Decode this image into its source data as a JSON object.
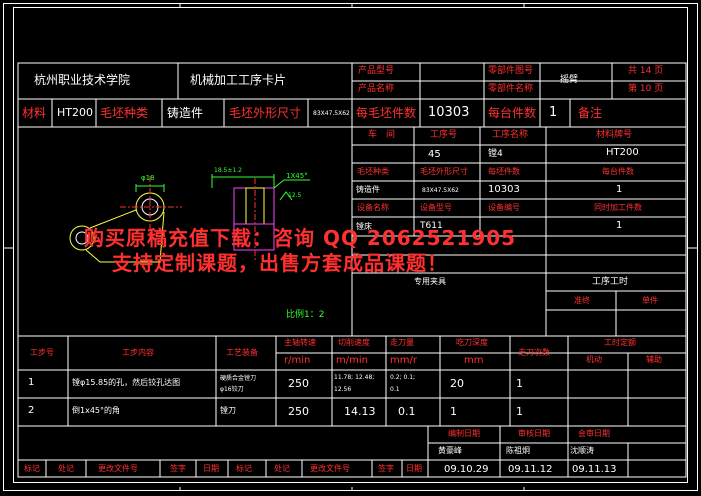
{
  "header": {
    "school": "杭州职业技术学院",
    "card_title": "机械加工工序卡片",
    "product_model_label": "产品型号",
    "product_name_label": "产品名称",
    "part_drawing_no_label": "零部件图号",
    "part_name_label": "零部件名称",
    "part_name_value": "摇臂",
    "total_pages": "共 14 页",
    "page_no": "第 10 页",
    "material_label": "材料",
    "material_value": "HT200",
    "blank_type_label": "毛坯种类",
    "blank_type_value": "铸造件",
    "blank_size_label": "毛坯外形尺寸",
    "blank_size_value": "83X47.5X62",
    "blanks_count_label": "每毛坯件数",
    "blanks_count_value": "10303",
    "per_unit_label": "每台件数",
    "per_unit_value": "1",
    "remark_label": "备注"
  },
  "info": {
    "workshop_label": "车　间",
    "process_no_label": "工序号",
    "process_name_label": "工序名称",
    "material_no_label": "材料牌号",
    "process_no_value": "45",
    "process_name_value": "镗4",
    "material_no_value": "HT200",
    "blank_type_label": "毛坯种类",
    "blank_size_label": "毛坯外形尺寸",
    "blank_count_label": "每坯件数",
    "per_unit_label": "每台件数",
    "blank_type_value": "铸造件",
    "blank_size_value": "83X47.5X62",
    "blank_count_value": "10303",
    "per_unit_value": "1",
    "equip_name_label": "设备名称",
    "equip_model_label": "设备型号",
    "equip_no_label": "设备编号",
    "simul_parts_label": "同时加工件数",
    "equip_name_value": "镗床",
    "equip_model_value": "T611",
    "simul_parts_value": "1",
    "fixture_value": "专用夹具",
    "work_hours_label": "工序工时",
    "prep_label": "准终",
    "unit_label": "单件"
  },
  "drawing": {
    "dim_diameter": "φ18",
    "dim_length": "18.5±1.2",
    "dim_chamfer": "1X45°",
    "dim_roughness": "12.5",
    "scale": "比例1：2"
  },
  "watermark": {
    "line1": "购买原稿充值下载：咨询 QQ 2062521905",
    "line2": "支持定制课题，出售方套成品课题！"
  },
  "steps_table": {
    "headers": {
      "step_no": "工步号",
      "content": "工步内容",
      "equipment": "工艺装备",
      "spindle": "主轴转速",
      "spindle_unit": "r/min",
      "cut_speed": "切削速度",
      "cut_speed_unit": "m/min",
      "feed": "走刀量",
      "feed_unit": "mm/r",
      "depth": "吃刀深度",
      "depth_unit": "mm",
      "passes": "走刀次数",
      "time_quota": "工时定额",
      "machine": "机动",
      "auxiliary": "辅助"
    },
    "rows": [
      {
        "no": "1",
        "content": "镗φ15.85的孔，然后铰孔达图",
        "equip": "硬质合金镗刀",
        "equip2": "φ16铰刀",
        "spindle": "250",
        "speed": "11.78; 12.48;",
        "speed2": "12.56",
        "feed": "0.2; 0.1;",
        "feed2": "0.1",
        "depth": "20",
        "passes": "1"
      },
      {
        "no": "2",
        "content": "倒1x45°的角",
        "equip": "镗刀",
        "equip2": "",
        "spindle": "250",
        "speed": "14.13",
        "speed2": "",
        "feed": "0.1",
        "feed2": "",
        "depth": "1",
        "passes": "1"
      }
    ]
  },
  "footer": {
    "prepared_label": "编制日期",
    "reviewed_label": "审核日期",
    "approved_label": "会审日期",
    "prepared_name": "黄豪峰",
    "reviewed_name": "陈祖炯",
    "approved_name": "沈顺涛",
    "prepared_date": "09.10.29",
    "reviewed_date": "09.11.12",
    "approved_date": "09.11.13",
    "mark_label": "标记",
    "count_label": "处记",
    "doc_label": "更改文件号",
    "sign_label": "签字",
    "date_label": "日期",
    "mark_label2": "标记",
    "count_label2": "处记",
    "doc_label2": "更改文件号",
    "sign_label2": "签字",
    "date_label2": "日期"
  }
}
